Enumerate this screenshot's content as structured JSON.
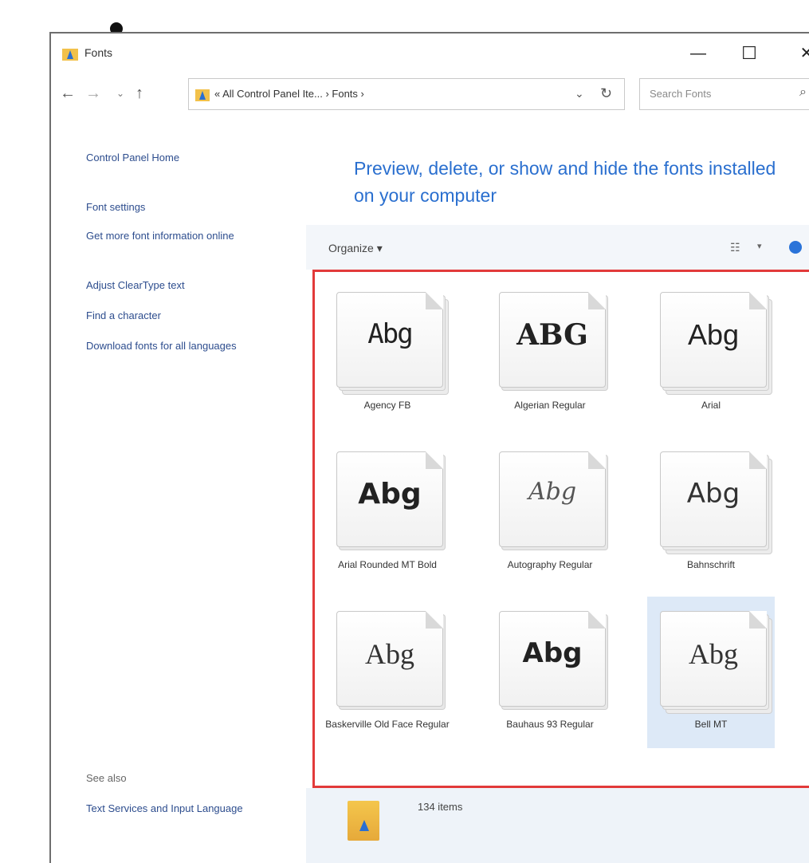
{
  "window": {
    "title": "Fonts",
    "minimize_glyph": "—",
    "maximize_glyph": "☐",
    "close_glyph": "✕"
  },
  "nav": {
    "back": "←",
    "forward": "→",
    "recent": "⌄",
    "up": "↑",
    "address": "« All Control Panel Ite...  ›  Fonts  ›",
    "address_dropdown": "⌄",
    "refresh": "↻",
    "search_placeholder": "Search Fonts",
    "search_glyph": "⌕"
  },
  "left_pane": {
    "control_panel_home": "Control Panel Home",
    "links": [
      "Font settings",
      "Get more font information online",
      "Adjust ClearType text",
      "Find a character",
      "Download fonts for all languages"
    ],
    "see_also_heading": "See also",
    "see_also_links": [
      "Text Services and Input Language"
    ]
  },
  "main": {
    "title": "Preview, delete, or show and hide the fonts installed on your computer"
  },
  "command_bar": {
    "organize": "Organize ▾",
    "view_glyph": "☷",
    "view_arrow": "▾"
  },
  "fonts": [
    {
      "name": "Agency FB",
      "sample": "Abg",
      "stacked": true,
      "selected": false
    },
    {
      "name": "Algerian Regular",
      "sample": "ABG",
      "stacked": false,
      "selected": false
    },
    {
      "name": "Arial",
      "sample": "Abg",
      "stacked": true,
      "selected": false
    },
    {
      "name": "Arial Rounded MT Bold",
      "sample": "Abg",
      "stacked": false,
      "selected": false
    },
    {
      "name": "Autography Regular",
      "sample": "Abg",
      "stacked": false,
      "selected": false
    },
    {
      "name": "Bahnschrift",
      "sample": "Abg",
      "stacked": true,
      "selected": false
    },
    {
      "name": "Baskerville Old Face Regular",
      "sample": "Abg",
      "stacked": false,
      "selected": false
    },
    {
      "name": "Bauhaus 93 Regular",
      "sample": "Abg",
      "stacked": false,
      "selected": false
    },
    {
      "name": "Bell MT",
      "sample": "Abg",
      "stacked": true,
      "selected": true
    }
  ],
  "details": {
    "item_count": "134 items"
  },
  "colors": {
    "link": "#2d4d8e",
    "title": "#2a6fcf",
    "highlight_border": "#e23a3a",
    "selection": "#dde9f7"
  }
}
